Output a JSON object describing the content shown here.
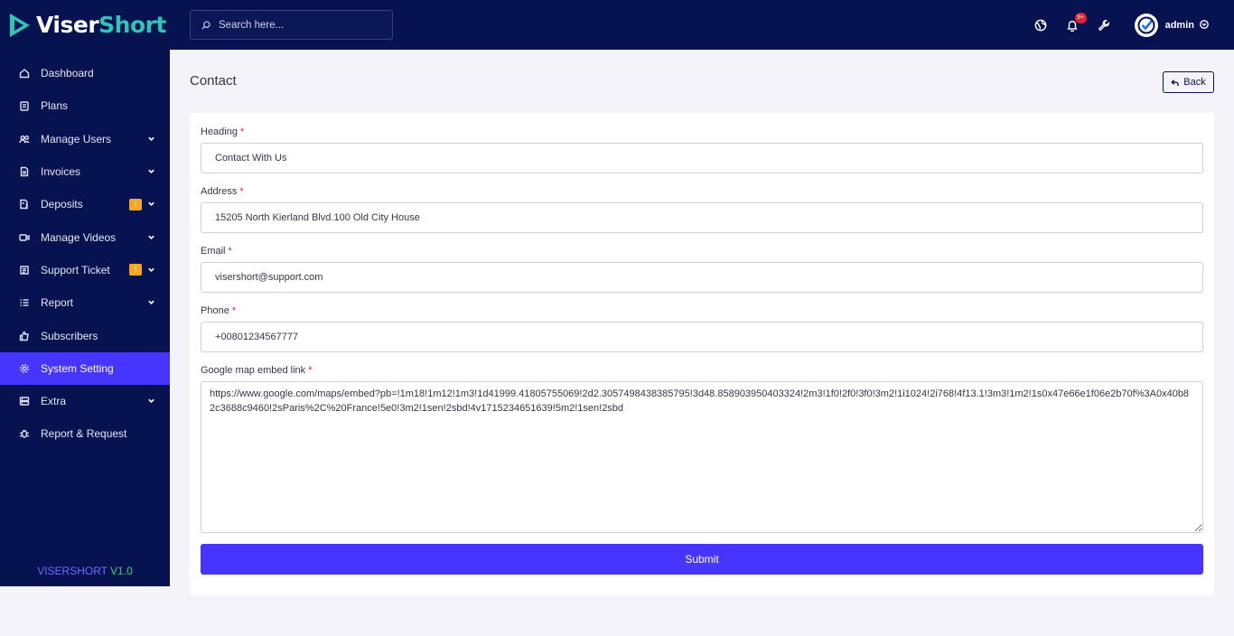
{
  "brand": {
    "logo_part1": "Viser",
    "logo_part2": "Short"
  },
  "sidebar": {
    "items": [
      {
        "label": "Dashboard",
        "icon": "home-icon"
      },
      {
        "label": "Plans",
        "icon": "clipboard-icon"
      },
      {
        "label": "Manage Users",
        "icon": "users-icon"
      },
      {
        "label": "Invoices",
        "icon": "file-icon"
      },
      {
        "label": "Deposits",
        "icon": "file-dollar-icon",
        "badge": "!"
      },
      {
        "label": "Manage Videos",
        "icon": "video-icon"
      },
      {
        "label": "Support Ticket",
        "icon": "ticket-icon",
        "badge": "!"
      },
      {
        "label": "Report",
        "icon": "list-icon"
      },
      {
        "label": "Subscribers",
        "icon": "thumbs-up-icon"
      },
      {
        "label": "System Setting",
        "icon": "gear-icon",
        "active": true
      },
      {
        "label": "Extra",
        "icon": "server-icon"
      },
      {
        "label": "Report & Request",
        "icon": "bug-icon"
      }
    ],
    "version_name": "VISERSHORT",
    "version_number": "V1.0"
  },
  "topbar": {
    "search_placeholder": "Search here...",
    "notification_count": "9+",
    "user_name": "admin"
  },
  "page": {
    "title": "Contact",
    "back_label": "Back"
  },
  "form": {
    "heading_label": "Heading",
    "heading_value": "Contact With Us",
    "address_label": "Address",
    "address_value": "15205 North Kierland Blvd.100 Old City House",
    "email_label": "Email",
    "email_value": "visershort@support.com",
    "phone_label": "Phone",
    "phone_value": "+00801234567777",
    "map_label": "Google map embed link",
    "map_value": "https://www.google.com/maps/embed?pb=!1m18!1m12!1m3!1d41999.41805755069!2d2.3057498438385795!3d48.858903950403324!2m3!1f0!2f0!3f0!3m2!1i1024!2i768!4f13.1!3m3!1m2!1s0x47e66e1f06e2b70f%3A0x40b82c3688c9460!2sParis%2C%20France!5e0!3m2!1sen!2sbd!4v1715234651639!5m2!1sen!2sbd",
    "required_mark": "*",
    "submit_label": "Submit"
  },
  "colors": {
    "sidebar_bg": "#071251",
    "accent": "#4634ff",
    "badge": "#f5a623",
    "required": "#ea1d2c"
  }
}
